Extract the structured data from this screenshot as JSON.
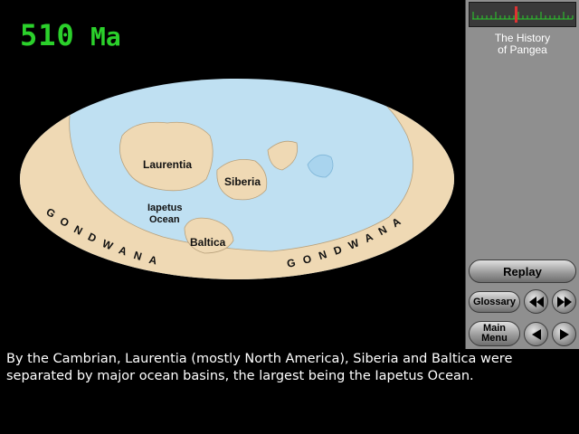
{
  "age_display": {
    "value": "510 Ma",
    "digits": "510",
    "unit": "Ma",
    "color": "#2bd02b"
  },
  "map": {
    "labels": {
      "laurentia": "Laurentia",
      "siberia": "Siberia",
      "iapetus_line1": "Iapetus",
      "iapetus_line2": "Ocean",
      "baltica": "Baltica",
      "gondwana_left": "GONDWANA",
      "gondwana_right": "GONDWANA"
    },
    "colors": {
      "ocean": "#bfe0f2",
      "land": "#efd9b4",
      "background": "#000000"
    }
  },
  "panel": {
    "title": "The History\nof Pangea",
    "buttons": {
      "replay": "Replay",
      "glossary": "Glossary",
      "main_menu": "Main\nMenu"
    },
    "icons": {
      "rewind": "rewind-icon",
      "fast_forward": "fast-forward-icon",
      "step_back": "step-back-icon",
      "step_forward": "step-forward-icon"
    }
  },
  "caption": "By the Cambrian, Laurentia (mostly North America), Siberia and Baltica were separated by major ocean basins, the largest being the Iapetus Ocean."
}
